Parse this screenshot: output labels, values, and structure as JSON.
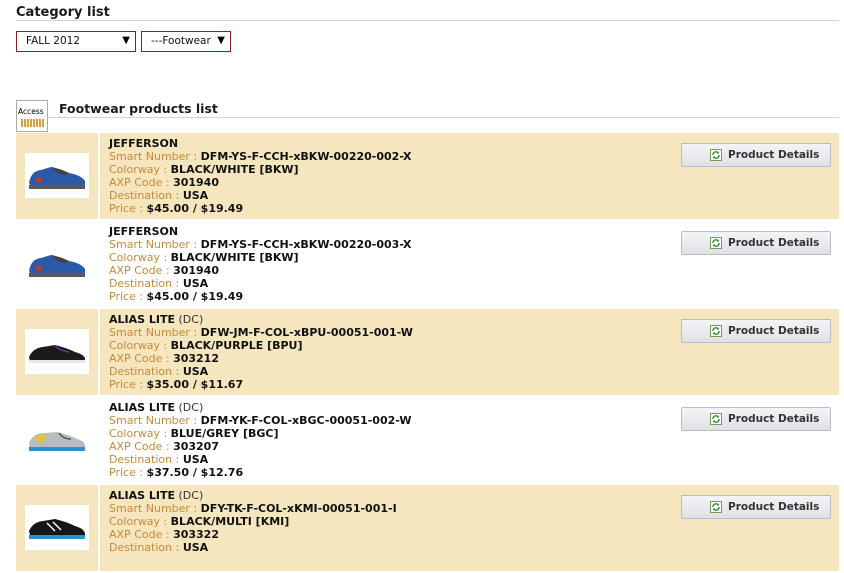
{
  "header": {
    "category_title": "Category list",
    "season_select": "FALL 2012",
    "category_select": "---Footwear",
    "logo_text": "Access",
    "list_title": "Footwear products list"
  },
  "labels": {
    "smart_number": "Smart Number : ",
    "colorway": "Colorway : ",
    "axp_code": "AXP Code : ",
    "destination": "Destination : ",
    "price": "Price : ",
    "details_button": "Product Details"
  },
  "colors": {
    "row_highlight": "#f5e6be",
    "label_orange": "#c8893a",
    "select_border": "#8a1c1c"
  },
  "products": [
    {
      "name": "JEFFERSON",
      "brand": "",
      "smart_number": "DFM-YS-F-CCH-xBKW-00220-002-X",
      "colorway": "BLACK/WHITE [BKW]",
      "axp_code": "301940",
      "destination": "USA",
      "price": "$45.00 / $19.49",
      "icon": "blue-sneaker-icon"
    },
    {
      "name": "JEFFERSON",
      "brand": "",
      "smart_number": "DFM-YS-F-CCH-xBKW-00220-003-X",
      "colorway": "BLACK/WHITE [BKW]",
      "axp_code": "301940",
      "destination": "USA",
      "price": "$45.00 / $19.49",
      "icon": "blue-sneaker-icon"
    },
    {
      "name": "ALIAS LITE",
      "brand": " (DC)",
      "smart_number": "DFW-JM-F-COL-xBPU-00051-001-W",
      "colorway": "BLACK/PURPLE [BPU]",
      "axp_code": "303212",
      "destination": "USA",
      "price": "$35.00 / $11.67",
      "icon": "black-sneaker-icon"
    },
    {
      "name": "ALIAS LITE",
      "brand": " (DC)",
      "smart_number": "DFM-YK-F-COL-xBGC-00051-002-W",
      "colorway": "BLUE/GREY [BGC]",
      "axp_code": "303207",
      "destination": "USA",
      "price": "$37.50 / $12.76",
      "icon": "grey-sneaker-icon"
    },
    {
      "name": "ALIAS LITE",
      "brand": " (DC)",
      "smart_number": "DFY-TK-F-COL-xKMI-00051-001-I",
      "colorway": "BLACK/MULTI [KMI]",
      "axp_code": "303322",
      "destination": "USA",
      "price": "",
      "icon": "black-multi-sneaker-icon"
    }
  ]
}
